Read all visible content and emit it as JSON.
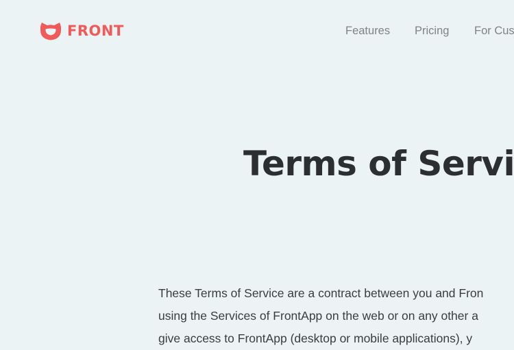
{
  "brand": {
    "name": "FRONT",
    "color": "#f05a5b"
  },
  "nav": {
    "items": [
      {
        "label": "Features"
      },
      {
        "label": "Pricing"
      },
      {
        "label": "For Cus"
      }
    ]
  },
  "page": {
    "title": "Terms of Servic",
    "paragraph_lines": [
      "These Terms of Service are a contract between you and Fron",
      "using the Services of FrontApp on the web or on any other a",
      "give access to FrontApp (desktop or mobile applications), y"
    ]
  },
  "colors": {
    "background": "#ecf3f5",
    "title": "#2c2f31",
    "nav_text": "#7e8386",
    "body_text": "#3a3d40"
  }
}
